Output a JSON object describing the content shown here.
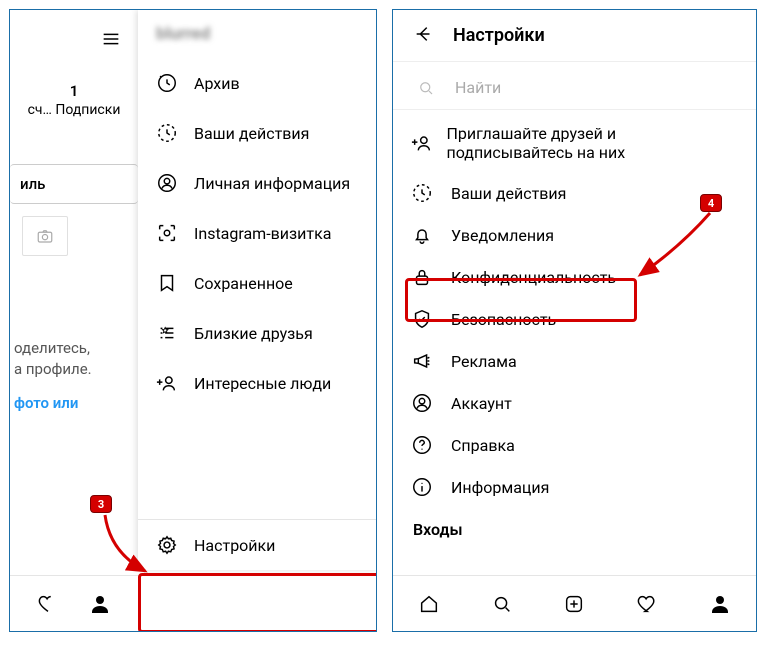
{
  "left": {
    "username": "blurred",
    "subscriptions_count": "1",
    "subscriptions_label": "сч… Подписки",
    "tab_label": "иль",
    "share_line1": "оделитесь,",
    "share_line2": "а профиле.",
    "photo_link": "фото или",
    "menu": [
      {
        "key": "archive",
        "label": "Архив"
      },
      {
        "key": "activity",
        "label": "Ваши действия"
      },
      {
        "key": "personal",
        "label": "Личная информация"
      },
      {
        "key": "nametag",
        "label": "Instagram-визитка"
      },
      {
        "key": "saved",
        "label": "Сохраненное"
      },
      {
        "key": "close-friends",
        "label": "Близкие друзья"
      },
      {
        "key": "discover",
        "label": "Интересные люди"
      }
    ],
    "settings_label": "Настройки",
    "badge": "3"
  },
  "right": {
    "title": "Настройки",
    "search_placeholder": "Найти",
    "items": [
      {
        "key": "invite-friends",
        "label": "Приглашайте друзей и подписывайтесь на них"
      },
      {
        "key": "activity",
        "label": "Ваши действия"
      },
      {
        "key": "notifications",
        "label": "Уведомления"
      },
      {
        "key": "privacy",
        "label": "Конфиденциальность"
      },
      {
        "key": "security",
        "label": "Безопасность"
      },
      {
        "key": "ads",
        "label": "Реклама"
      },
      {
        "key": "account",
        "label": "Аккаунт"
      },
      {
        "key": "help",
        "label": "Справка"
      },
      {
        "key": "about",
        "label": "Информация"
      }
    ],
    "logins_header": "Входы",
    "badge": "4"
  }
}
